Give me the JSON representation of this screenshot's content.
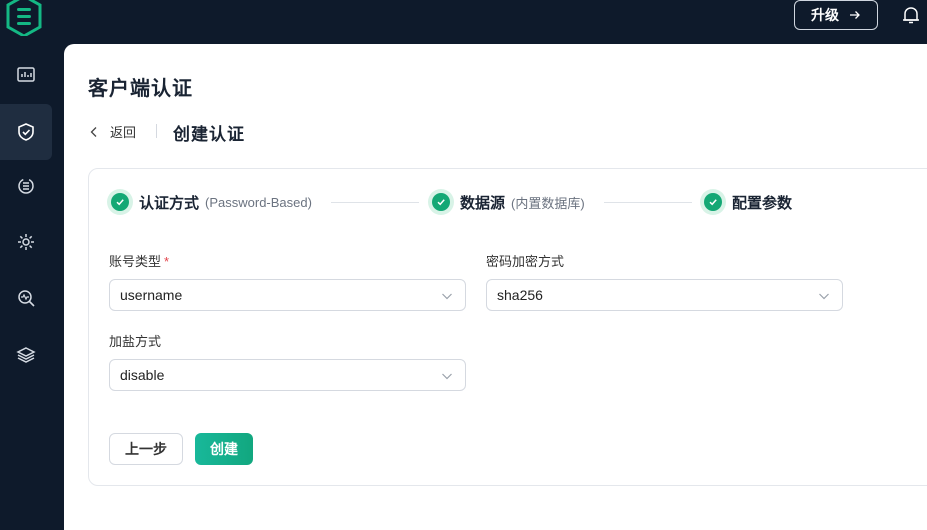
{
  "colors": {
    "accent": "#14a875",
    "sidebar_bg": "#0e1a2b",
    "required": "#e2434b"
  },
  "sidebar": {
    "logo_icon": "emqx-logo-icon",
    "items": [
      {
        "name": "dashboard",
        "icon": "monitor-chart-icon"
      },
      {
        "name": "access-control",
        "icon": "shield-check-icon",
        "active": true
      },
      {
        "name": "integration",
        "icon": "data-integration-icon"
      },
      {
        "name": "management",
        "icon": "gear-settings-icon"
      },
      {
        "name": "diagnose",
        "icon": "search-pulse-icon"
      },
      {
        "name": "extensions",
        "icon": "layers-icon"
      }
    ]
  },
  "topbar": {
    "upgrade_label": "升级",
    "upgrade_icon": "arrow-right-icon",
    "bell_icon": "bell-icon"
  },
  "page": {
    "title": "客户端认证",
    "back_label": "返回",
    "subtitle": "创建认证"
  },
  "steps": [
    {
      "title": "认证方式",
      "desc": "(Password-Based)",
      "status": "done"
    },
    {
      "title": "数据源",
      "desc": "(内置数据库)",
      "status": "done"
    },
    {
      "title": "配置参数",
      "desc": "",
      "status": "current"
    }
  ],
  "form": {
    "account_type": {
      "label": "账号类型",
      "required_mark": "*",
      "value": "username"
    },
    "password_hash": {
      "label": "密码加密方式",
      "value": "sha256"
    },
    "salt_position": {
      "label": "加盐方式",
      "value": "disable"
    }
  },
  "actions": {
    "prev_label": "上一步",
    "create_label": "创建"
  }
}
